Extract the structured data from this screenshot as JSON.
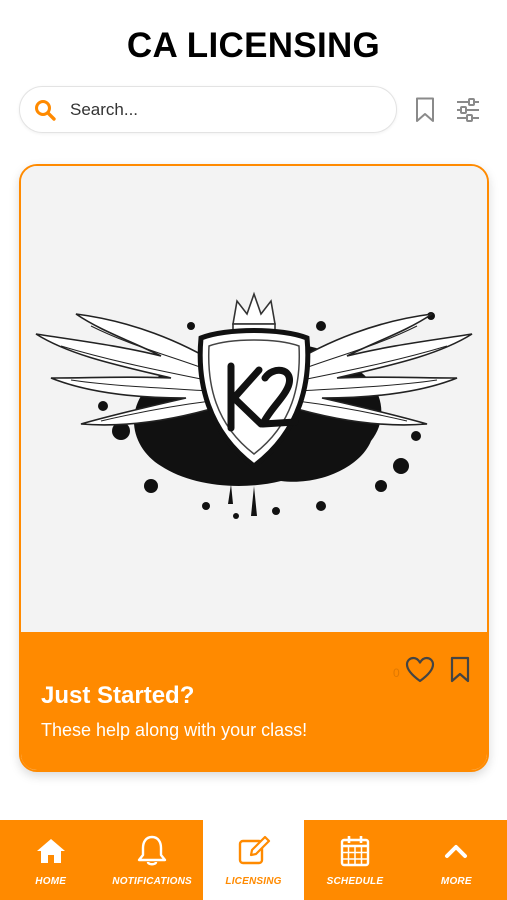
{
  "header": {
    "title": "CA LICENSING"
  },
  "search": {
    "placeholder": "Search..."
  },
  "icons": {
    "search": "search-icon",
    "bookmark": "bookmark-icon",
    "filter": "sliders-icon",
    "like": "heart-icon",
    "logo": "k2-winged-shield-logo"
  },
  "card": {
    "likes_count": "0",
    "title": "Just Started?",
    "subtitle": "These help along with your class!"
  },
  "nav": {
    "items": [
      {
        "label": "HOME",
        "icon": "home-icon"
      },
      {
        "label": "NOTIFICATIONS",
        "icon": "bell-icon"
      },
      {
        "label": "LICENSING",
        "icon": "edit-icon",
        "active": true
      },
      {
        "label": "SCHEDULE",
        "icon": "calendar-icon"
      },
      {
        "label": "MORE",
        "icon": "chevron-up-icon"
      }
    ]
  },
  "colors": {
    "accent": "#ff8a00",
    "text": "#000000",
    "card_bg": "#f3f3f3"
  }
}
